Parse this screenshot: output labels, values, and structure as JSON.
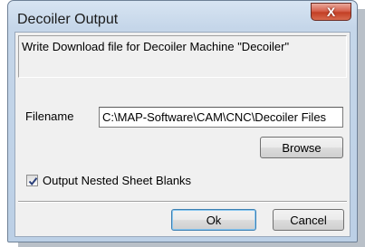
{
  "window": {
    "title": "Decoiler Output",
    "close_glyph": "X"
  },
  "message": "Write Download file for Decoiler Machine \"Decoiler\"",
  "filename": {
    "label": "Filename",
    "value": "C:\\MAP-Software\\CAM\\CNC\\Decoiler Files"
  },
  "buttons": {
    "browse": "Browse",
    "ok": "Ok",
    "cancel": "Cancel"
  },
  "checkbox": {
    "label": "Output Nested Sheet Blanks",
    "checked": true
  }
}
